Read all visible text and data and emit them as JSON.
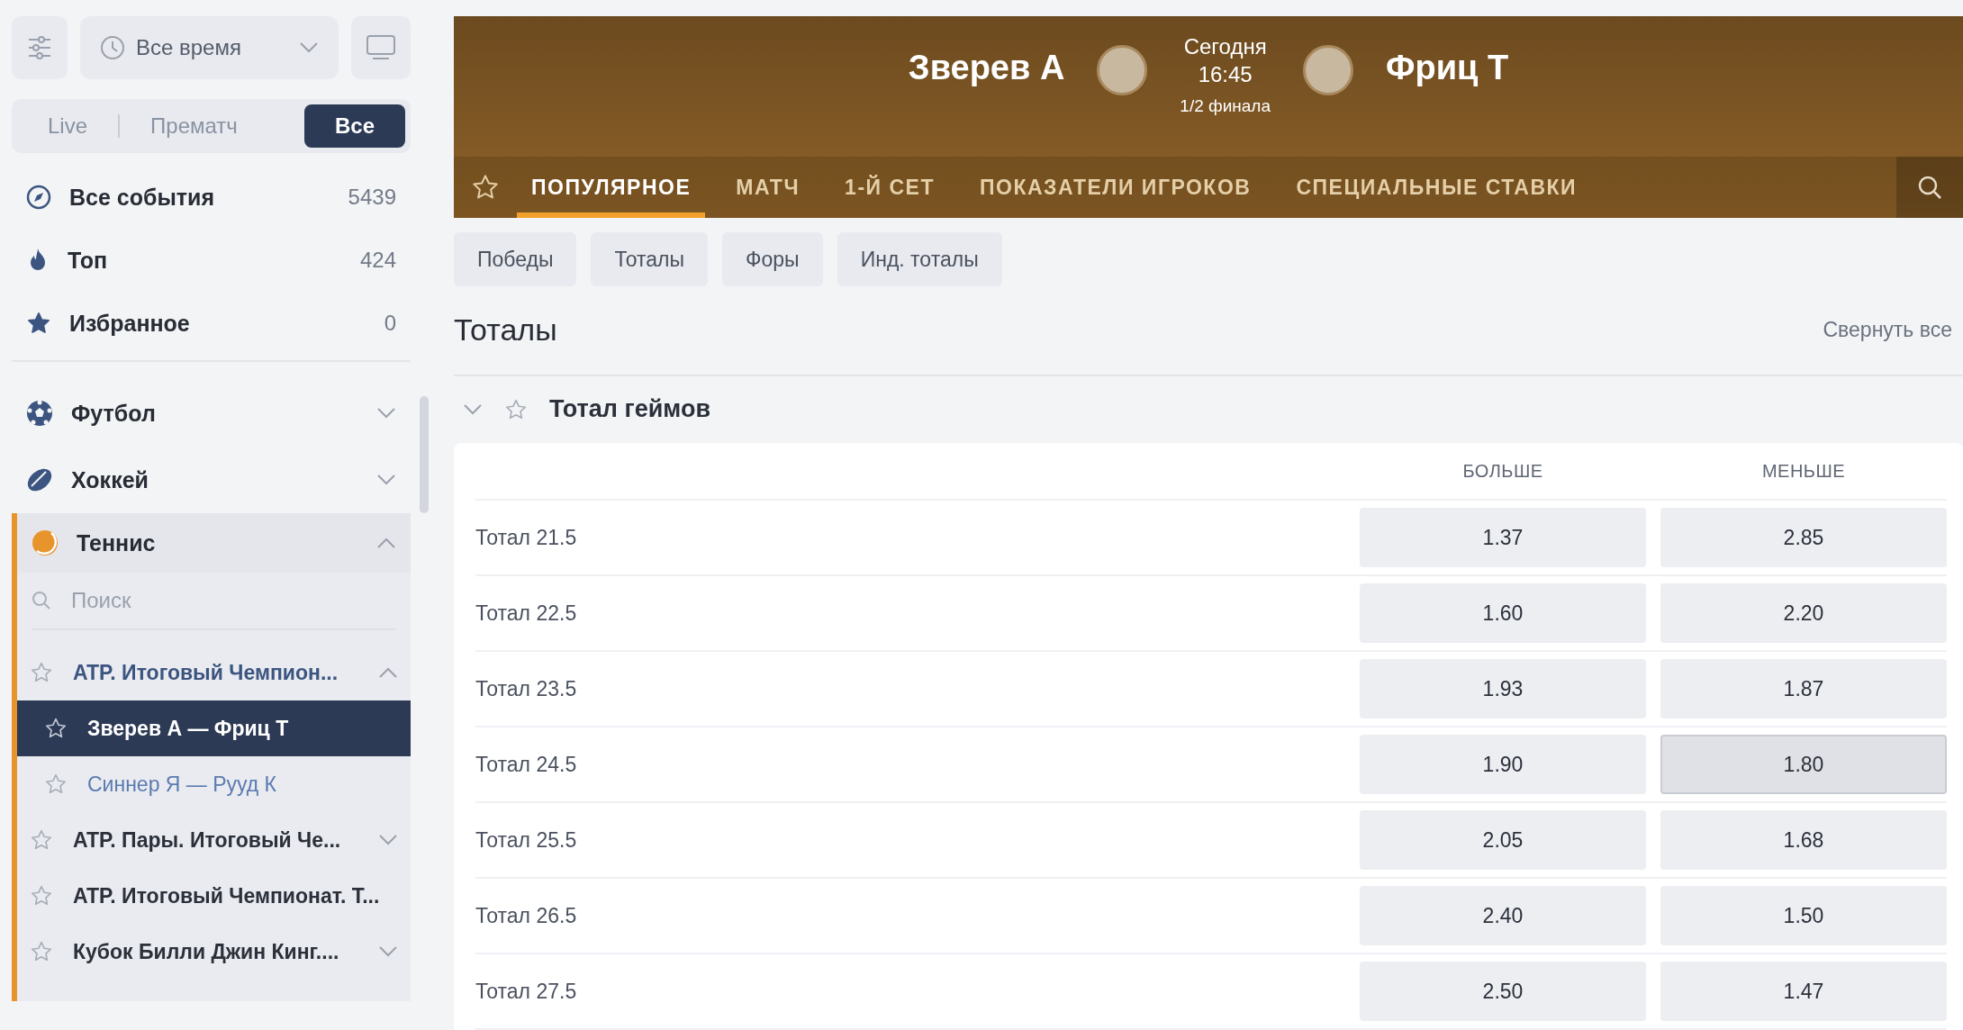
{
  "sidebar": {
    "time_filter": "Все время",
    "modes": [
      {
        "label": "Live",
        "selected": false
      },
      {
        "label": "Прематч",
        "selected": false
      },
      {
        "label": "Все",
        "selected": true
      }
    ],
    "quick_links": [
      {
        "kind": "compass",
        "label": "Все события",
        "count": "5439"
      },
      {
        "kind": "fire",
        "label": "Топ",
        "count": "424"
      },
      {
        "kind": "star",
        "label": "Избранное",
        "count": "0"
      }
    ],
    "sports": [
      {
        "kind": "football",
        "label": "Футбол",
        "expanded": false
      },
      {
        "kind": "hockey",
        "label": "Хоккей",
        "expanded": false
      },
      {
        "kind": "tennis",
        "label": "Теннис",
        "expanded": true,
        "search_placeholder": "Поиск",
        "tournaments": [
          {
            "label": "ATP. Итоговый Чемпион...",
            "expanded": true,
            "children": [
              {
                "label": "Зверев А — Фриц Т",
                "selected": true
              },
              {
                "label": "Синнер Я — Рууд К",
                "selected": false
              }
            ]
          },
          {
            "label": "ATP. Пары. Итоговый Че...",
            "expanded": false
          },
          {
            "label": "ATP. Итоговый Чемпионат. Т..."
          },
          {
            "label": "Кубок Билли Джин Кинг....",
            "expanded": false
          }
        ]
      }
    ]
  },
  "match": {
    "player_1": "Зверев А",
    "player_2": "Фриц Т",
    "day": "Сегодня",
    "time": "16:45",
    "stage": "1/2 финала",
    "tabs": [
      {
        "label": "ПОПУЛЯРНОЕ",
        "selected": true
      },
      {
        "label": "МАТЧ",
        "selected": false
      },
      {
        "label": "1-Й СЕТ",
        "selected": false
      },
      {
        "label": "ПОКАЗАТЕЛИ ИГРОКОВ",
        "selected": false
      },
      {
        "label": "СПЕЦИАЛЬНЫЕ СТАВКИ",
        "selected": false
      }
    ]
  },
  "filters": [
    "Победы",
    "Тоталы",
    "Форы",
    "Инд. тоталы"
  ],
  "section": {
    "title": "Тоталы",
    "collapse_all": "Свернуть все"
  },
  "market": {
    "title": "Тотал геймов",
    "expanded": true,
    "columns": [
      "БОЛЬШЕ",
      "МЕНЬШЕ"
    ],
    "rows": [
      {
        "label": "Тотал 21.5",
        "odds": [
          {
            "value": "1.37",
            "highlighted": false
          },
          {
            "value": "2.85",
            "highlighted": false
          }
        ]
      },
      {
        "label": "Тотал 22.5",
        "odds": [
          {
            "value": "1.60",
            "highlighted": false
          },
          {
            "value": "2.20",
            "highlighted": false
          }
        ]
      },
      {
        "label": "Тотал 23.5",
        "odds": [
          {
            "value": "1.93",
            "highlighted": false
          },
          {
            "value": "1.87",
            "highlighted": false
          }
        ]
      },
      {
        "label": "Тотал 24.5",
        "odds": [
          {
            "value": "1.90",
            "highlighted": false
          },
          {
            "value": "1.80",
            "highlighted": true
          }
        ]
      },
      {
        "label": "Тотал 25.5",
        "odds": [
          {
            "value": "2.05",
            "highlighted": false
          },
          {
            "value": "1.68",
            "highlighted": false
          }
        ]
      },
      {
        "label": "Тотал 26.5",
        "odds": [
          {
            "value": "2.40",
            "highlighted": false
          },
          {
            "value": "1.50",
            "highlighted": false
          }
        ]
      },
      {
        "label": "Тотал 27.5",
        "odds": [
          {
            "value": "2.50",
            "highlighted": false
          },
          {
            "value": "1.47",
            "highlighted": false
          }
        ]
      }
    ]
  }
}
